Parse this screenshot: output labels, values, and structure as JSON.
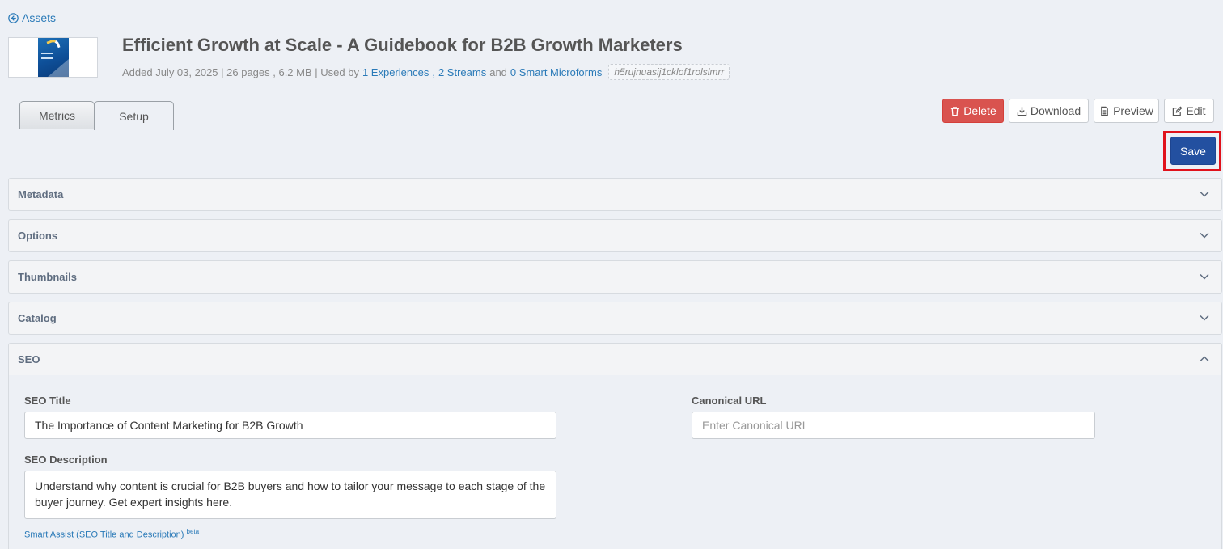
{
  "nav": {
    "back_label": "Assets"
  },
  "asset": {
    "title": "Efficient Growth at Scale - A Guidebook for B2B Growth Marketers",
    "added": "Added July 03, 2025 | 26 pages , 6.2 MB | Used by",
    "experiences_link": "1 Experiences",
    "comma": ",",
    "streams_link": "2 Streams",
    "and_text": "and",
    "microforms_link": "0 Smart Microforms",
    "id": "h5rujnuasij1cklof1rolslmrr"
  },
  "tabs": [
    {
      "label": "Metrics",
      "active": false
    },
    {
      "label": "Setup",
      "active": true
    }
  ],
  "actions": {
    "delete": "Delete",
    "download": "Download",
    "preview": "Preview",
    "edit": "Edit",
    "save": "Save"
  },
  "panels": [
    {
      "label": "Metadata",
      "expanded": false
    },
    {
      "label": "Options",
      "expanded": false
    },
    {
      "label": "Thumbnails",
      "expanded": false
    },
    {
      "label": "Catalog",
      "expanded": false
    },
    {
      "label": "SEO",
      "expanded": true
    }
  ],
  "seo": {
    "title_label": "SEO Title",
    "title_value": "The Importance of Content Marketing for B2B Growth",
    "canonical_label": "Canonical URL",
    "canonical_placeholder": "Enter Canonical URL",
    "description_label": "SEO Description",
    "description_value": "Understand why content is crucial for B2B buyers and how to tailor your message to each stage of the buyer journey. Get expert insights here.",
    "smart_assist": "Smart Assist (SEO Title and Description)",
    "beta": "beta"
  },
  "colors": {
    "background": "#edf0f5",
    "link": "#2a7ab8",
    "delete": "#d9534f",
    "save": "#2350a0",
    "highlight": "#e0121b"
  },
  "icons": [
    "arrow-circle-left-icon",
    "trash-icon",
    "download-icon",
    "file-icon",
    "edit-icon",
    "chevron-down-icon",
    "chevron-up-icon"
  ]
}
